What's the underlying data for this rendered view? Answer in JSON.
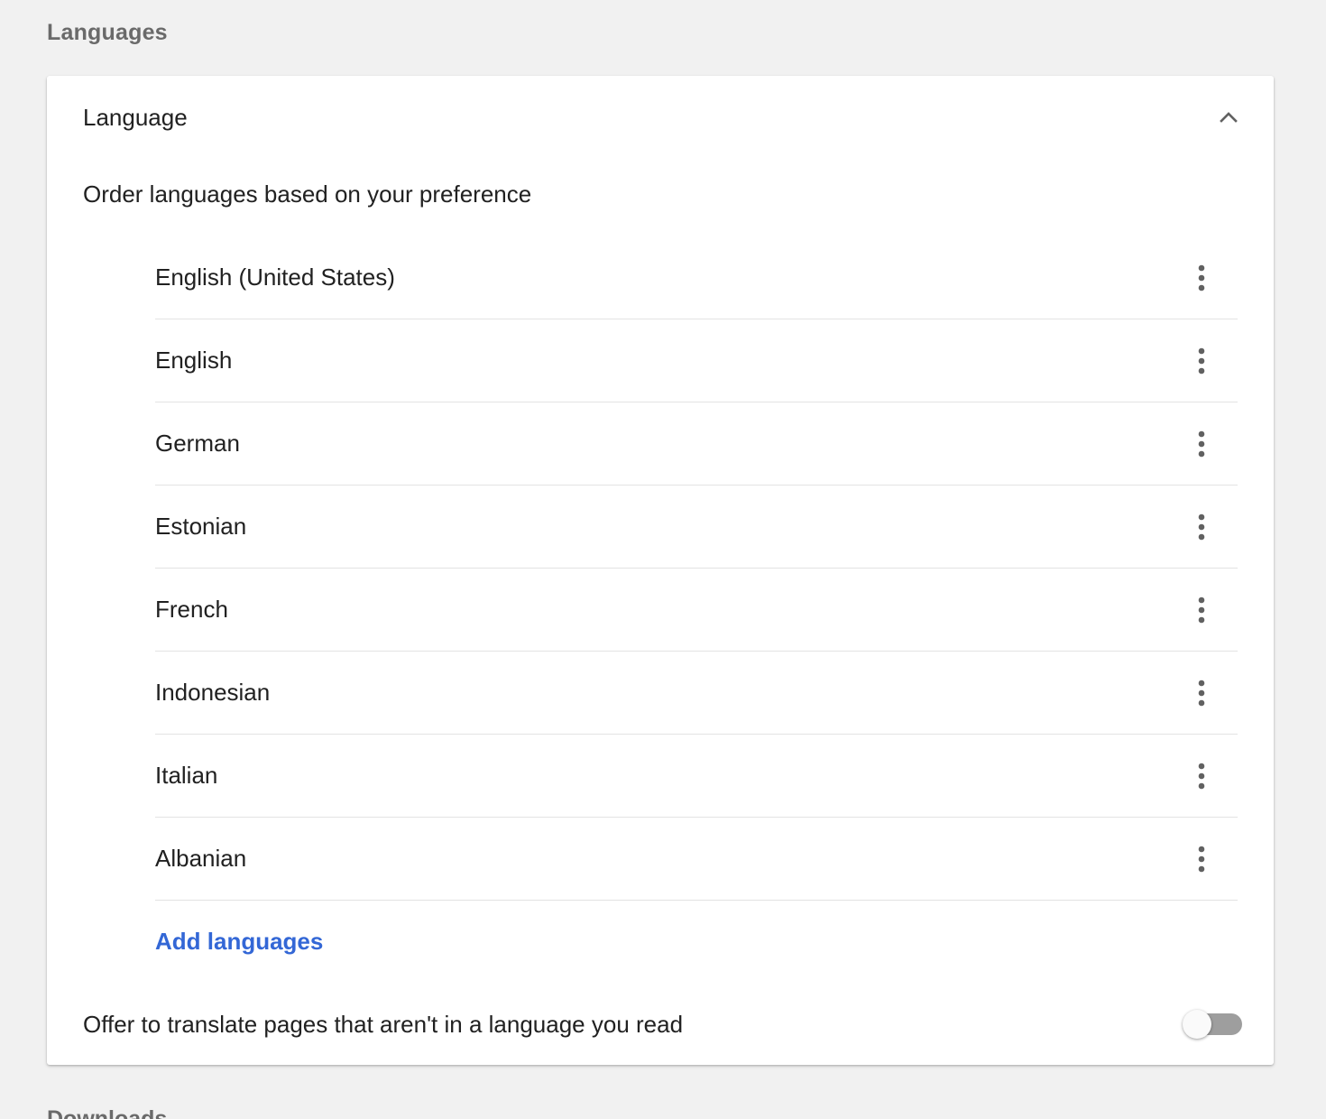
{
  "section": {
    "title": "Languages"
  },
  "card": {
    "header_title": "Language",
    "collapse_icon": "chevron-up-icon",
    "instructions": "Order languages based on your preference",
    "languages": [
      {
        "label": "English (United States)",
        "menu_icon": "more-vert-icon"
      },
      {
        "label": "English",
        "menu_icon": "more-vert-icon"
      },
      {
        "label": "German",
        "menu_icon": "more-vert-icon"
      },
      {
        "label": "Estonian",
        "menu_icon": "more-vert-icon"
      },
      {
        "label": "French",
        "menu_icon": "more-vert-icon"
      },
      {
        "label": "Indonesian",
        "menu_icon": "more-vert-icon"
      },
      {
        "label": "Italian",
        "menu_icon": "more-vert-icon"
      },
      {
        "label": "Albanian",
        "menu_icon": "more-vert-icon"
      }
    ],
    "add_languages_label": "Add languages",
    "translate": {
      "label": "Offer to translate pages that aren't in a language you read",
      "enabled": false
    }
  },
  "next_section": {
    "title": "Downloads"
  },
  "colors": {
    "background": "#f1f1f1",
    "card": "#ffffff",
    "link": "#3367d6",
    "text": "#212121",
    "muted": "#6a6a6a",
    "toggle_track_off": "#9e9e9e"
  }
}
